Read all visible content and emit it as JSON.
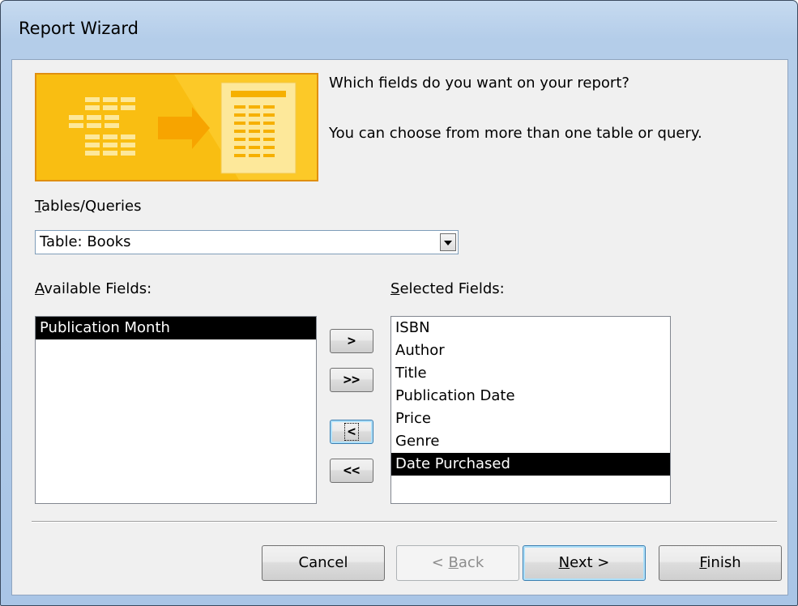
{
  "window": {
    "title": "Report Wizard"
  },
  "prompt": {
    "line1": "Which fields do you want on your report?",
    "line2": "You can choose from more than one table or query."
  },
  "tables": {
    "label_accel": "T",
    "label_rest": "ables/Queries",
    "selected": "Table: Books"
  },
  "available": {
    "label_accel": "A",
    "label_rest": "vailable Fields:",
    "items": [
      "Publication Month"
    ],
    "selected_index": 0
  },
  "selected_fields": {
    "label_accel": "S",
    "label_rest": "elected Fields:",
    "items": [
      "ISBN",
      "Author",
      "Title",
      "Publication Date",
      "Price",
      "Genre",
      "Date Purchased"
    ],
    "selected_index": 6
  },
  "move_buttons": {
    "add_one": ">",
    "add_all": ">>",
    "remove_one": "<",
    "remove_all": "<<"
  },
  "buttons": {
    "cancel": "Cancel",
    "back_pre": "< ",
    "back_accel": "B",
    "back_rest": "ack",
    "back_enabled": false,
    "next_accel": "N",
    "next_rest": "ext >",
    "finish_accel": "F",
    "finish_rest": "inish"
  },
  "colors": {
    "banner_orange": "#f8b90e",
    "selection": "#000000",
    "title_bar": "#b4cde9"
  },
  "icons": {
    "banner": "report-wizard-banner-icon",
    "dropdown": "chevron-down-icon"
  }
}
